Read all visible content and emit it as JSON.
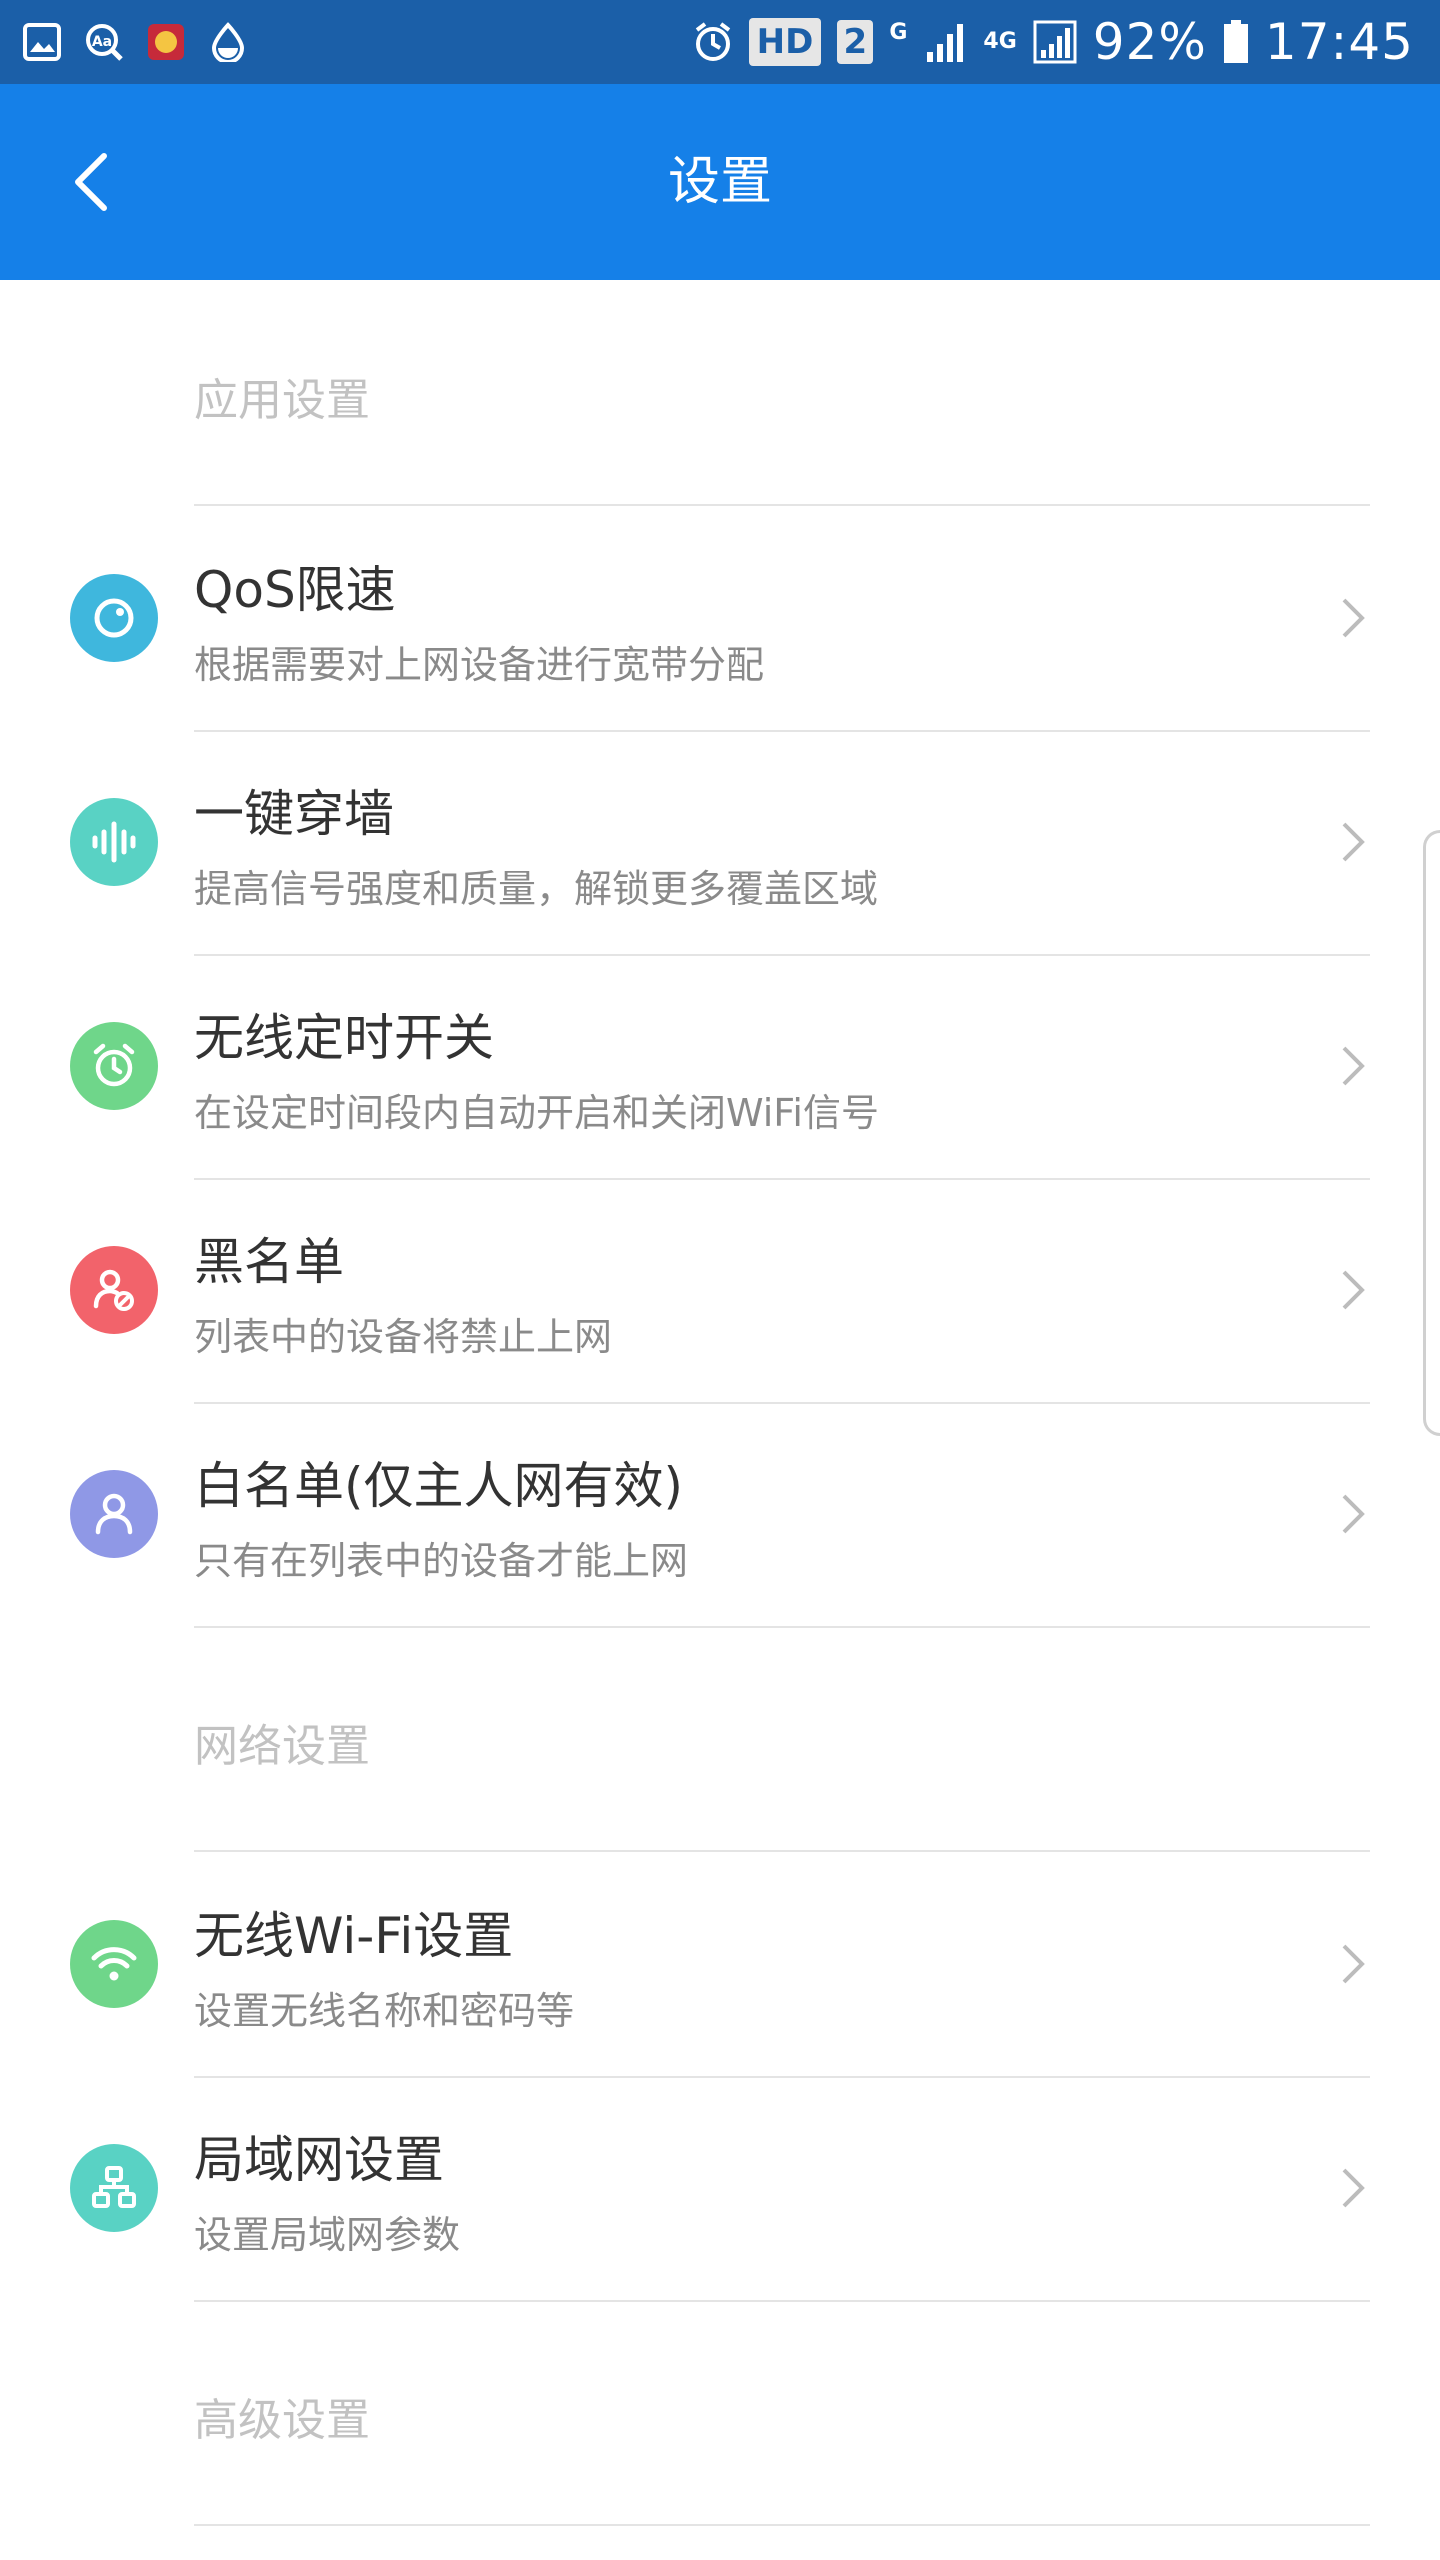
{
  "status_bar": {
    "left_icons": [
      "gallery-icon",
      "aa-icon",
      "app-badge-icon",
      "drop-icon"
    ],
    "hd_label": "HD",
    "sim_label": "2",
    "g_label": "G",
    "network_label": "4G",
    "battery_percent": "92%",
    "time": "17:45"
  },
  "appbar": {
    "title": "设置",
    "back_icon": "chevron-left-icon"
  },
  "sections": [
    {
      "header": "应用设置",
      "items": [
        {
          "title": "QoS限速",
          "subtitle": "根据需要对上网设备进行宽带分配",
          "icon": "speed-dial-icon",
          "color": "#3fb7dd"
        },
        {
          "title": "一键穿墙",
          "subtitle": "提高信号强度和质量，解锁更多覆盖区域",
          "icon": "signal-wave-icon",
          "color": "#59d2c4"
        },
        {
          "title": "无线定时开关",
          "subtitle": "在设定时间段内自动开启和关闭WiFi信号",
          "icon": "alarm-clock-icon",
          "color": "#6fd68a"
        },
        {
          "title": "黑名单",
          "subtitle": "列表中的设备将禁止上网",
          "icon": "user-block-icon",
          "color": "#f2636b"
        },
        {
          "title": "白名单(仅主人网有效)",
          "subtitle": "只有在列表中的设备才能上网",
          "icon": "user-icon",
          "color": "#8f98e6"
        }
      ]
    },
    {
      "header": "网络设置",
      "items": [
        {
          "title": "无线Wi-Fi设置",
          "subtitle": "设置无线名称和密码等",
          "icon": "wifi-icon",
          "color": "#6fd68a"
        },
        {
          "title": "局域网设置",
          "subtitle": "设置局域网参数",
          "icon": "lan-icon",
          "color": "#59d2c4"
        }
      ]
    },
    {
      "header": "高级设置",
      "items": []
    }
  ]
}
